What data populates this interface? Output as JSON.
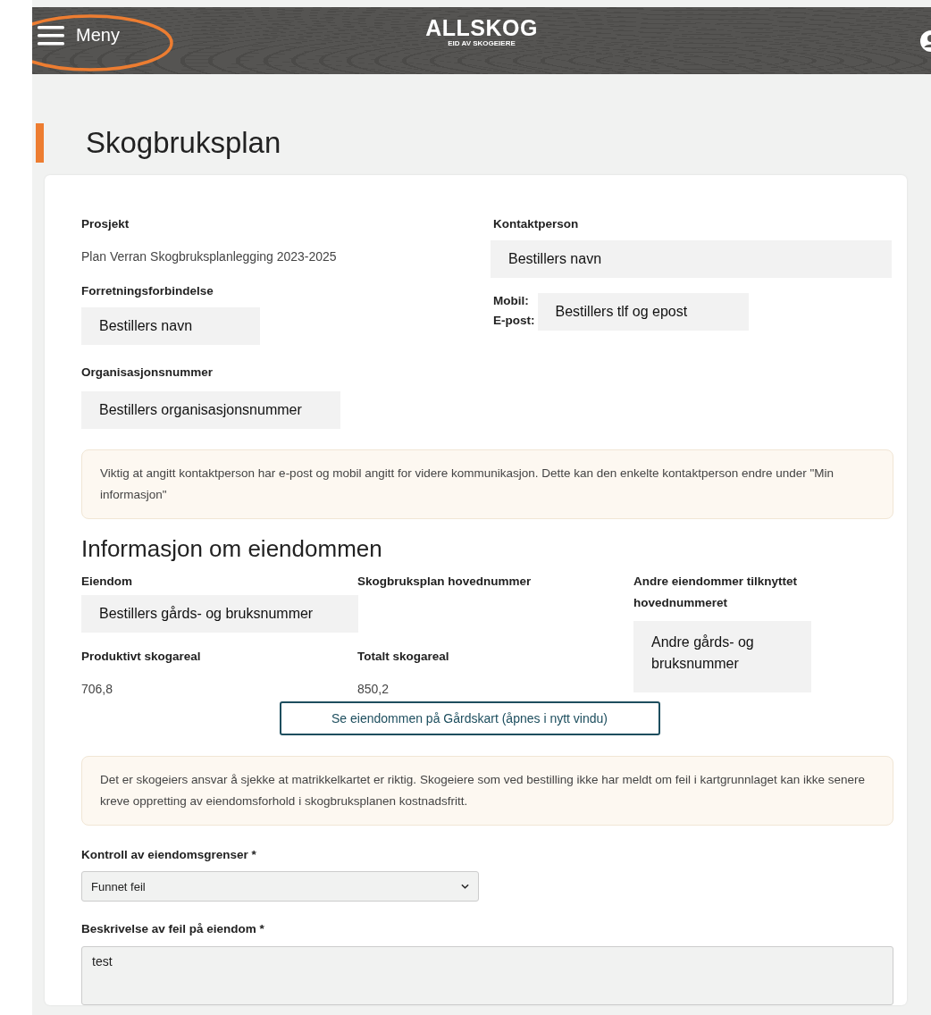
{
  "header": {
    "menu_label": "Meny",
    "logo": "ALLSKOG",
    "logo_tagline": "EID AV SKOGEIERE"
  },
  "page_title": "Skogbruksplan",
  "order": {
    "project": {
      "label": "Prosjekt",
      "value": "Plan Verran Skogbruksplanlegging 2023-2025"
    },
    "business": {
      "label": "Forretningsforbindelse",
      "value": "Bestillers navn"
    },
    "org_number": {
      "label": "Organisasjonsnummer",
      "value": "Bestillers organisasjonsnummer"
    },
    "contact": {
      "label": "Kontaktperson",
      "value": "Bestillers navn",
      "mobile_label": "Mobil:",
      "email_label": "E-post:",
      "phone_email": "Bestillers tlf og epost"
    }
  },
  "contact_notice": "Viktig at angitt kontaktperson har e-post og mobil angitt for videre kommunikasjon. Dette kan den enkelte kontaktperson endre under \"Min informasjon\"",
  "property": {
    "heading": "Informasjon om eiendommen",
    "property_label": "Eiendom",
    "property_value": "Bestillers gårds- og bruksnummer",
    "main_number_label": "Skogbruksplan hovednummer",
    "other_label": "Andre eiendommer tilknyttet hovednummeret",
    "other_value": "Andre gårds- og bruksnummer",
    "productive_label": "Produktivt skogareal",
    "productive_value": "706,8",
    "total_label": "Totalt skogareal",
    "total_value": "850,2",
    "map_button": "Se eiendommen på Gårdskart (åpnes i nytt vindu)"
  },
  "map_notice": "Det er skogeiers ansvar å sjekke at matrikkelkartet er riktig. Skogeiere som ved bestilling ikke har meldt om feil i kartgrunnlaget kan ikke senere kreve oppretting av eiendomsforhold i skogbruksplanen kostnadsfritt.",
  "boundary_check": {
    "label": "Kontroll av eiendomsgrenser *",
    "value": "Funnet feil"
  },
  "error_description": {
    "label": "Beskrivelse av feil på eiendom *",
    "value": "test"
  }
}
